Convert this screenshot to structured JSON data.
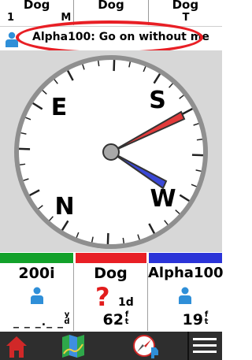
{
  "top_tabs": [
    {
      "name": "Dog",
      "letter": "1"
    },
    {
      "name": "Dog",
      "letter": "M"
    },
    {
      "name": "Dog",
      "letter": "T"
    }
  ],
  "message": {
    "sender": "Alpha100",
    "text": "Alpha100: Go on without me"
  },
  "compass": {
    "labels": {
      "north": "N",
      "east": "E",
      "south": "S",
      "west": "W"
    },
    "red_needle_color": "#e23b3b",
    "blue_needle_color": "#3a48d6"
  },
  "strip_colors": [
    "#12a12a",
    "#e81f25",
    "#2b34d8"
  ],
  "panels": [
    {
      "name": "200i",
      "icon": "person-icon",
      "distance_text": "_ _ _._ _",
      "unit": "yd"
    },
    {
      "name": "Dog",
      "status": "?",
      "age": "1d",
      "distance": "62",
      "unit": "ft"
    },
    {
      "name": "Alpha100",
      "icon": "person-icon",
      "distance": "19",
      "unit": "ft"
    }
  ],
  "bottom_bar": [
    "home-icon",
    "map-icon",
    "compass-dog-icon",
    "menu-icon"
  ]
}
